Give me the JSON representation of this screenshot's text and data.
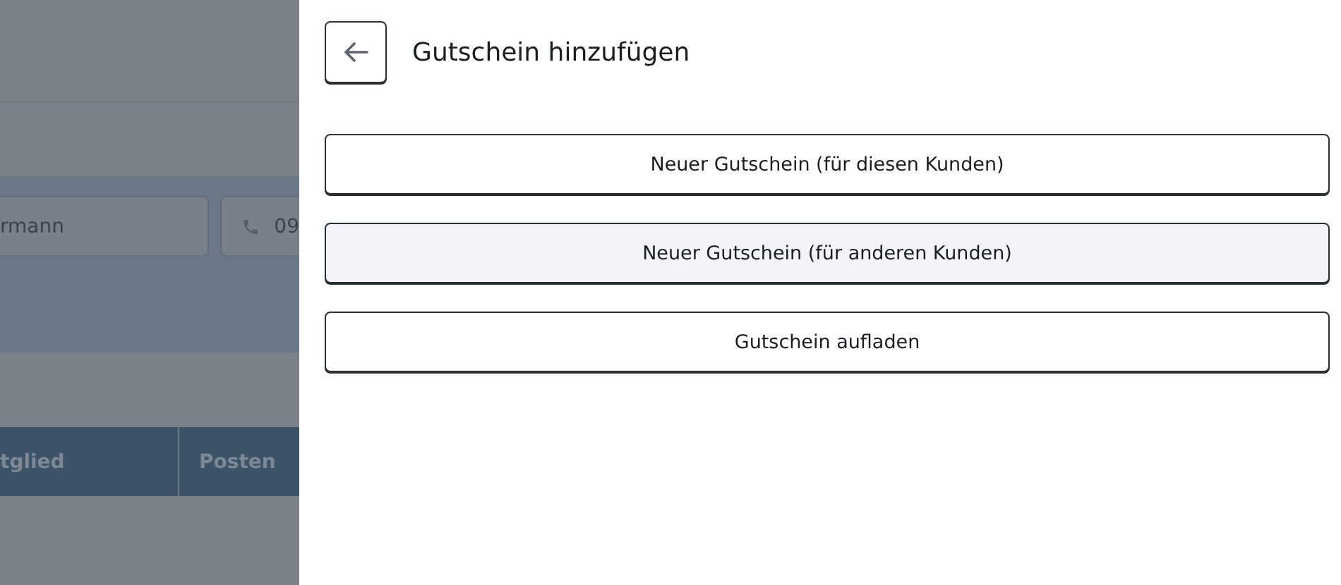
{
  "background": {
    "name_field": {
      "value": "rmann"
    },
    "phone_field": {
      "value": "09"
    },
    "table": {
      "columns": [
        "tglied",
        "Posten"
      ]
    }
  },
  "drawer": {
    "title": "Gutschein hinzufügen",
    "options": [
      {
        "label": "Neuer Gutschein (für diesen Kunden)",
        "highlighted": false
      },
      {
        "label": "Neuer Gutschein (für anderen Kunden)",
        "highlighted": true
      },
      {
        "label": "Gutschein aufladen",
        "highlighted": false
      }
    ]
  }
}
